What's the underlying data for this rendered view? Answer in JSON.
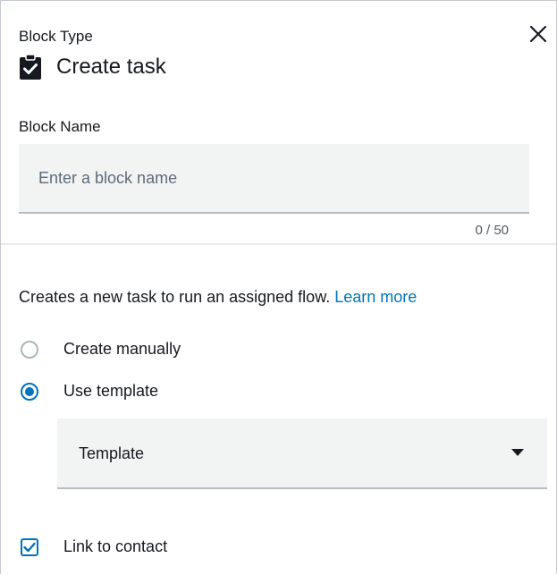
{
  "header": {
    "block_type_label": "Block Type",
    "block_title": "Create task",
    "close_icon": "close-icon",
    "block_icon": "clipboard-check-icon"
  },
  "block_name": {
    "label": "Block Name",
    "value": "",
    "placeholder": "Enter a block name",
    "char_count": "0 / 50"
  },
  "description": {
    "text": "Creates a new task to run an assigned flow. ",
    "link_text": "Learn more"
  },
  "creation_mode": {
    "options": [
      {
        "label": "Create manually",
        "selected": false
      },
      {
        "label": "Use template",
        "selected": true
      }
    ]
  },
  "template": {
    "selected_value": "Template",
    "dropdown_icon": "caret-down-icon"
  },
  "link_to_contact": {
    "label": "Link to contact",
    "checked": true
  },
  "colors": {
    "accent": "#0073bb",
    "text": "#16191f",
    "input_bg": "#f2f3f3",
    "muted_text": "#545b64"
  }
}
